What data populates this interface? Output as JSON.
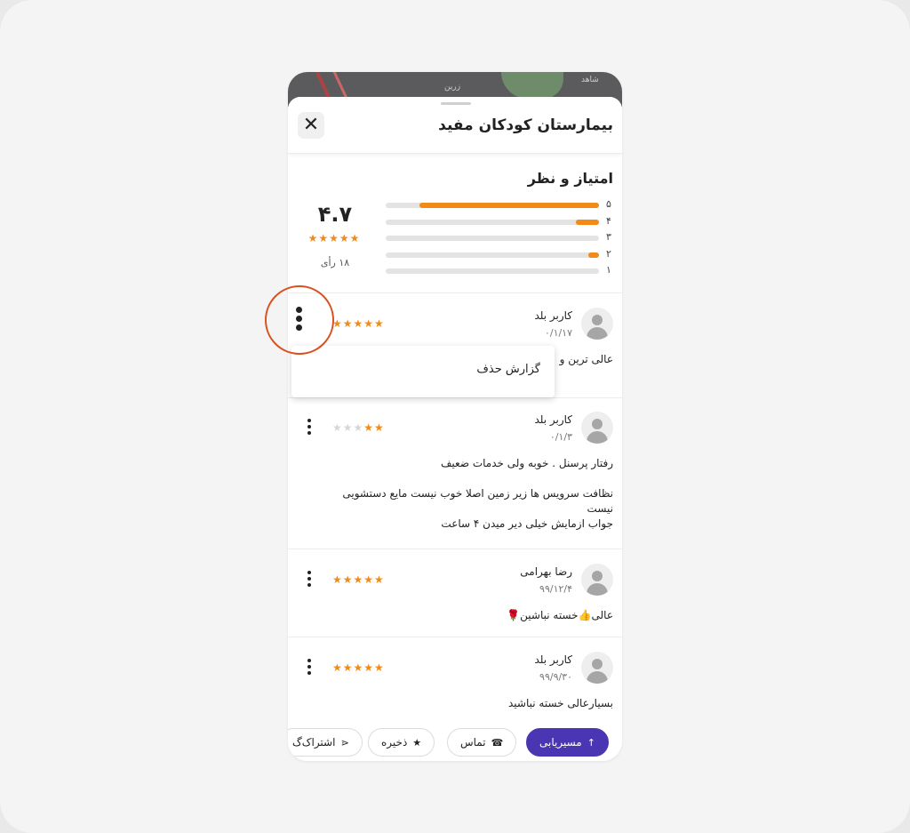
{
  "header": {
    "title": "بیمارستان کودکان مفید",
    "close_icon": "close-icon"
  },
  "map": {
    "label_1": "زرین",
    "label_2": "شاهد"
  },
  "rating": {
    "section_title": "امتیاز و نظر",
    "average": "۴.۷",
    "average_stars": "★★★★★",
    "votes": "۱۸ رأی",
    "bars": [
      {
        "label": "۵",
        "fraction": 0.84
      },
      {
        "label": "۴",
        "fraction": 0.11
      },
      {
        "label": "۳",
        "fraction": 0
      },
      {
        "label": "۲",
        "fraction": 0.05
      },
      {
        "label": "۱",
        "fraction": 0
      }
    ]
  },
  "reviews": [
    {
      "name": "کاربر بلد",
      "date": "۰/۱/۱۷",
      "stars_on": "★★★★★",
      "stars_off": "",
      "text": "عالی ترین و"
    },
    {
      "name": "کاربر بلد",
      "date": "۰/۱/۳",
      "stars_on": "★★",
      "stars_off": "★★★",
      "text": "رفتار پرسنل . خوبه ولی خدمات ضعیف\n\nنظافت سرویس ها زیر زمین اصلا خوب نیست مایع دستشویی نیست\nجواب ازمایش خیلی دیر میدن ۴ ساعت"
    },
    {
      "name": "رضا بهرامی",
      "date": "۹۹/۱۲/۴",
      "stars_on": "★★★★★",
      "stars_off": "",
      "text": "عالی👍خسته نباشین🌹"
    },
    {
      "name": "کاربر بلد",
      "date": "۹۹/۹/۳۰",
      "stars_on": "★★★★★",
      "stars_off": "",
      "text": "بسیارعالی خسته نباشید"
    }
  ],
  "popup": {
    "report_label": "گزارش حذف"
  },
  "actions": {
    "route": {
      "label": "مسیریابی",
      "icon": "↑"
    },
    "call": {
      "label": "تماس",
      "icon": "☎"
    },
    "save": {
      "label": "ذخیره",
      "icon": "★"
    },
    "share": {
      "label": "اشتراک‌گ",
      "icon": "⋖"
    }
  },
  "colors": {
    "accent": "#f28a17",
    "primary": "#4a36b3",
    "highlight_ring": "#d9501e"
  }
}
